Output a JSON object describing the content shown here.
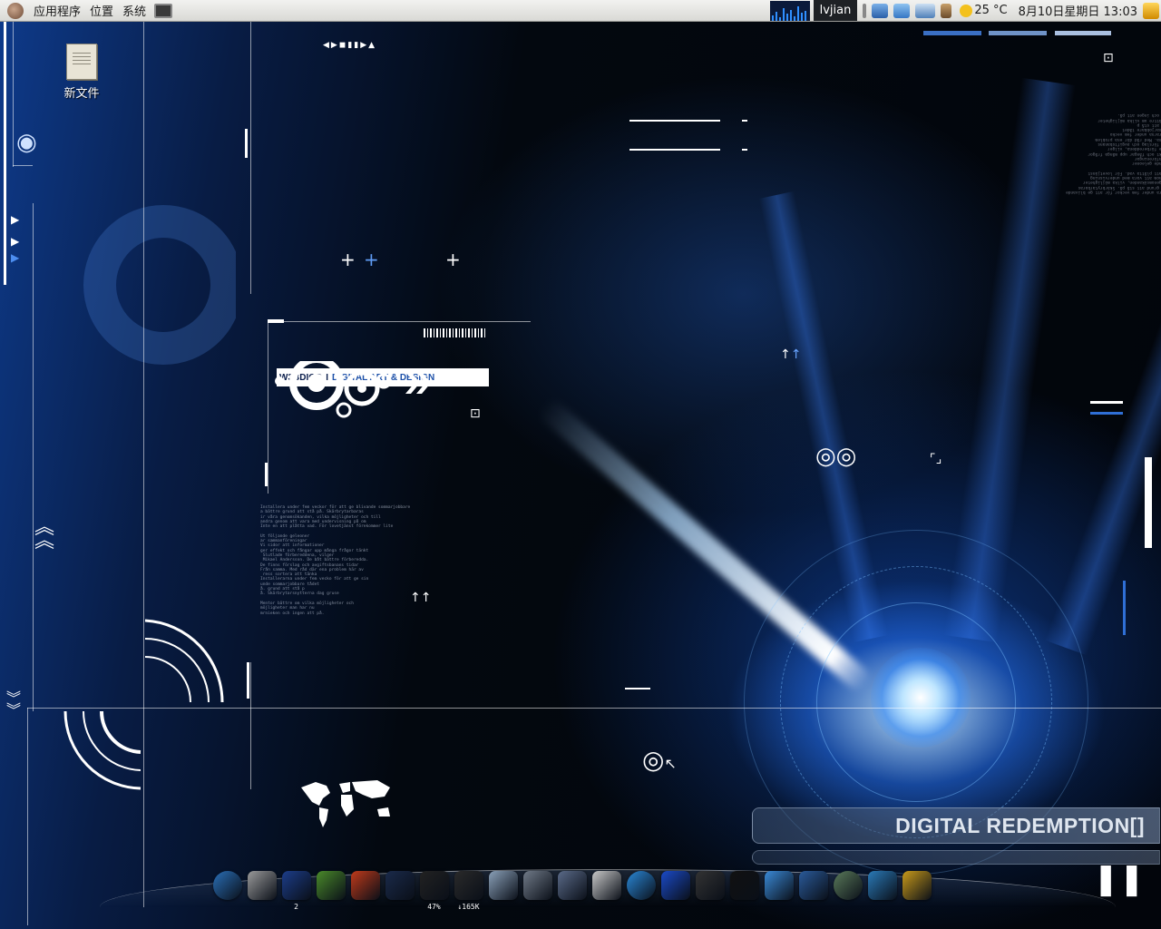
{
  "panel": {
    "menus": [
      "应用程序",
      "位置",
      "系统"
    ],
    "user": "lvjian",
    "weather": "25 °C",
    "clock": "8月10日星期日 13:03"
  },
  "desktop": {
    "icons": [
      {
        "label": "新文件",
        "icon": "text-document-icon"
      }
    ]
  },
  "wallpaper": {
    "badge_brand": "W3BDIOD",
    "badge_sep": "I",
    "badge_tagline": "DIGITAL ART & DESIGN",
    "banner": "DIGITAL REDEMPTION[]"
  },
  "dock": {
    "items": [
      {
        "name": "network-manager-icon",
        "label": "",
        "color": "#2a6fb8"
      },
      {
        "name": "trash-icon",
        "label": "",
        "color": "#9a9a9a"
      },
      {
        "name": "workspace-switcher-icon",
        "label": "2",
        "color": "#1c3d8a"
      },
      {
        "name": "terminal-icon",
        "label": "",
        "color": "#4a8a2a"
      },
      {
        "name": "cd-burner-icon",
        "label": "",
        "color": "#c03a1a"
      },
      {
        "name": "clock-icon",
        "label": "",
        "color": "#1a2a4a"
      },
      {
        "name": "cpu-monitor-icon",
        "label": "47%",
        "color": "#222222"
      },
      {
        "name": "network-monitor-icon",
        "label": "↓165K",
        "color": "#2a2a2a"
      },
      {
        "name": "weather-icon",
        "label": "",
        "color": "#8aa0b8"
      },
      {
        "name": "gnome-foot-icon",
        "label": "",
        "color": "#707a88"
      },
      {
        "name": "settings-robot-icon",
        "label": "",
        "color": "#5a6a88"
      },
      {
        "name": "desktop-icon",
        "label": "",
        "color": "#c8c8c8"
      },
      {
        "name": "media-player-icon",
        "label": "",
        "color": "#2a88d8"
      },
      {
        "name": "video-editor-icon",
        "label": "",
        "color": "#1a4ac8"
      },
      {
        "name": "mp3-player-icon",
        "label": "",
        "color": "#333333"
      },
      {
        "name": "tux-penguin-icon",
        "label": "",
        "color": "#111111"
      },
      {
        "name": "messenger-icon",
        "label": "",
        "color": "#3a8ad8"
      },
      {
        "name": "thunderbird-icon",
        "label": "",
        "color": "#2a5a9a"
      },
      {
        "name": "frog-gear-icon",
        "label": "",
        "color": "#5a7a5a"
      },
      {
        "name": "swirl-icon",
        "label": "",
        "color": "#2a7ab8"
      },
      {
        "name": "linux-logo-icon",
        "label": "",
        "color": "#c89a1a"
      }
    ]
  }
}
